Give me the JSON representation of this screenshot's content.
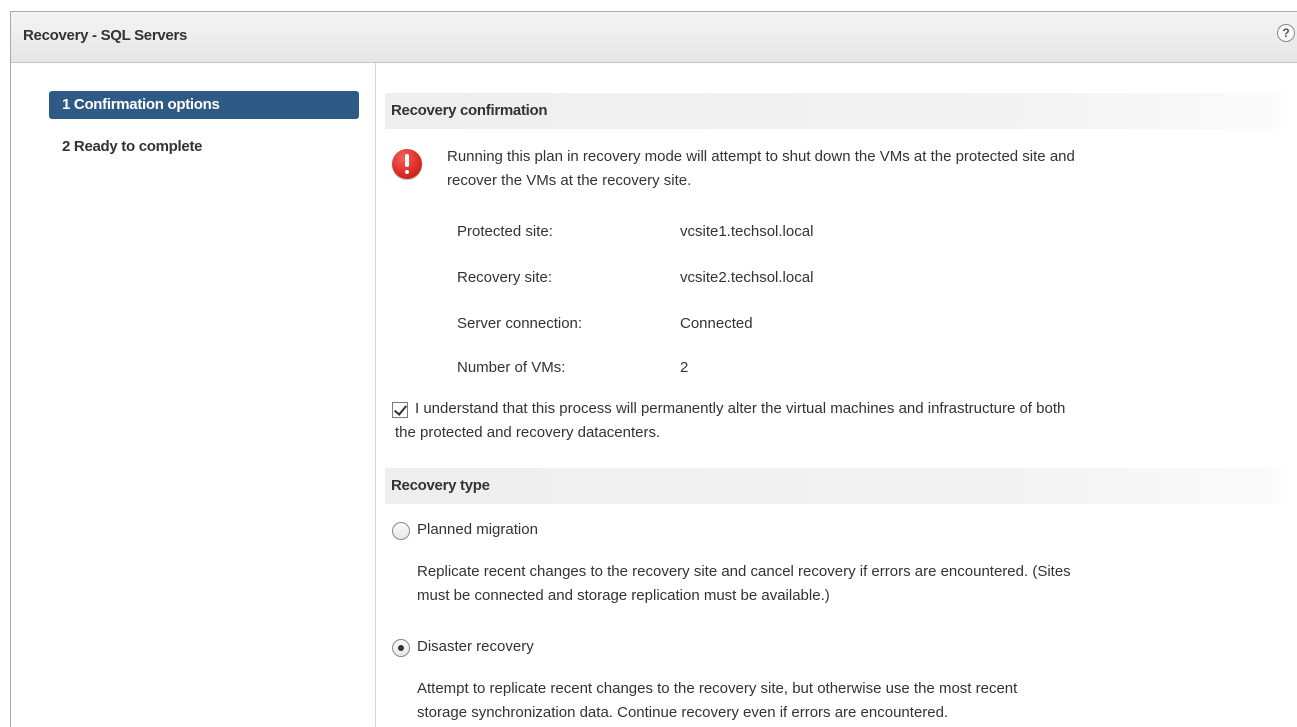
{
  "window": {
    "title": "Recovery - SQL Servers",
    "help_label": "?"
  },
  "sidebar": {
    "steps": [
      {
        "label": "1 Confirmation options",
        "active": true
      },
      {
        "label": "2 Ready to complete",
        "active": false
      }
    ]
  },
  "confirmation": {
    "header": "Recovery confirmation",
    "warning_icon": "error-exclamation-icon",
    "warning_line1": "Running this plan in recovery mode will attempt to shut down the VMs at the protected site and",
    "warning_line2": "recover the VMs at the recovery site.",
    "rows": [
      {
        "label": "Protected site:",
        "value": "vcsite1.techsol.local"
      },
      {
        "label": "Recovery site:",
        "value": "vcsite2.techsol.local"
      },
      {
        "label": "Server connection:",
        "value": "Connected"
      },
      {
        "label": "Number of VMs:",
        "value": "2"
      }
    ],
    "acknowledge_checked": true,
    "acknowledge_line1": "I understand that this process will permanently alter the virtual machines and infrastructure of both",
    "acknowledge_line2": "the protected and recovery datacenters."
  },
  "recovery_type": {
    "header": "Recovery type",
    "options": [
      {
        "label": "Planned migration",
        "selected": false,
        "desc_line1": "Replicate recent changes to the recovery site and cancel recovery if errors are encountered. (Sites",
        "desc_line2": "must be connected and storage replication must be available.)"
      },
      {
        "label": "Disaster recovery",
        "selected": true,
        "desc_line1": "Attempt to replicate recent changes to the recovery site, but otherwise use the most recent",
        "desc_line2": "storage synchronization data. Continue recovery even if errors are encountered."
      }
    ]
  },
  "colors": {
    "active_step_bg": "#2f5a85",
    "alert_red": "#dc2d25"
  }
}
